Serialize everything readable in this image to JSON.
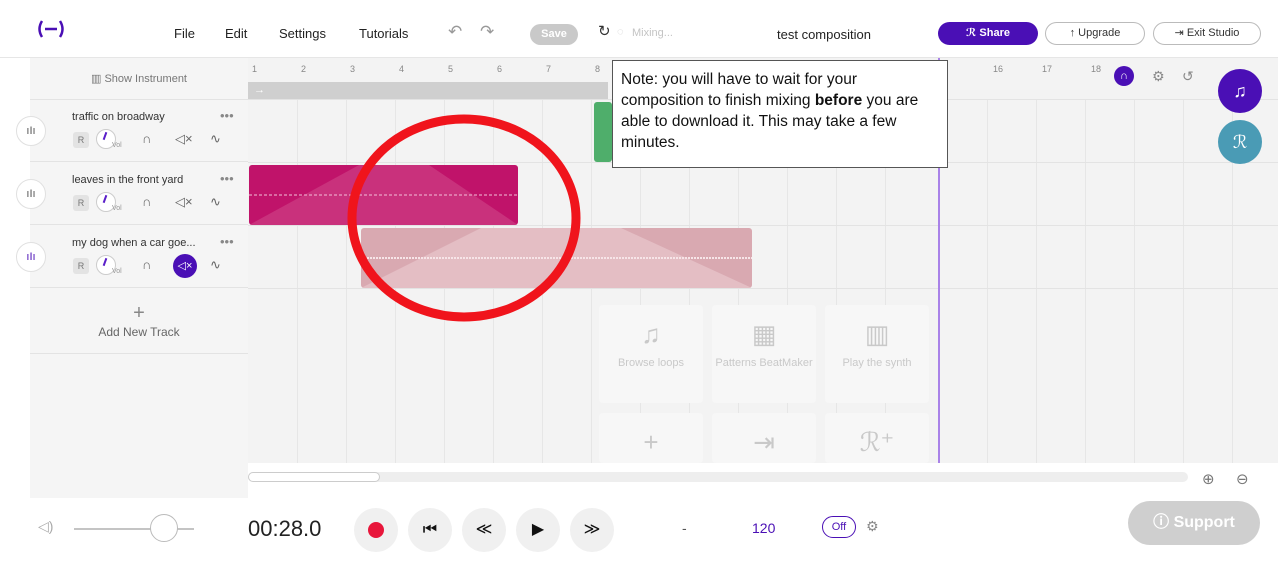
{
  "header": {
    "menu": [
      "File",
      "Edit",
      "Settings",
      "Tutorials"
    ],
    "save_label": "Save",
    "mixing_label": "Mixing...",
    "composition_title": "test composition",
    "share_label": "Share",
    "upgrade_label": "Upgrade",
    "exit_label": "Exit Studio"
  },
  "sidebar": {
    "show_instrument_label": "Show Instrument",
    "tracks": [
      {
        "name": "traffic on broadway",
        "muted": false
      },
      {
        "name": "leaves in the front yard",
        "muted": false
      },
      {
        "name": "my dog when a car goe...",
        "muted": true
      }
    ],
    "r_label": "R",
    "vol_label": "Vol",
    "add_track_label": "Add New Track"
  },
  "ruler": [
    "1",
    "2",
    "3",
    "4",
    "5",
    "6",
    "7",
    "8",
    "16",
    "17",
    "18"
  ],
  "note": {
    "before": "Note: you will have to wait for your composition to finish mixing ",
    "bold": "before",
    "after": " you are able to download it. This may take a few minutes."
  },
  "browse": {
    "loops": "Browse loops",
    "patterns": "Patterns BeatMaker",
    "synth": "Play the synth"
  },
  "transport": {
    "time": "00:28.0",
    "dash": "-",
    "tempo": "120",
    "metronome": "Off"
  },
  "support_label": "Support",
  "colors": {
    "accent": "#4a0fb5",
    "clip_pink": "#c0136a",
    "clip_light": "#d9a9b1",
    "record": "#e8163b",
    "fab_teal": "#4a9bb5"
  }
}
